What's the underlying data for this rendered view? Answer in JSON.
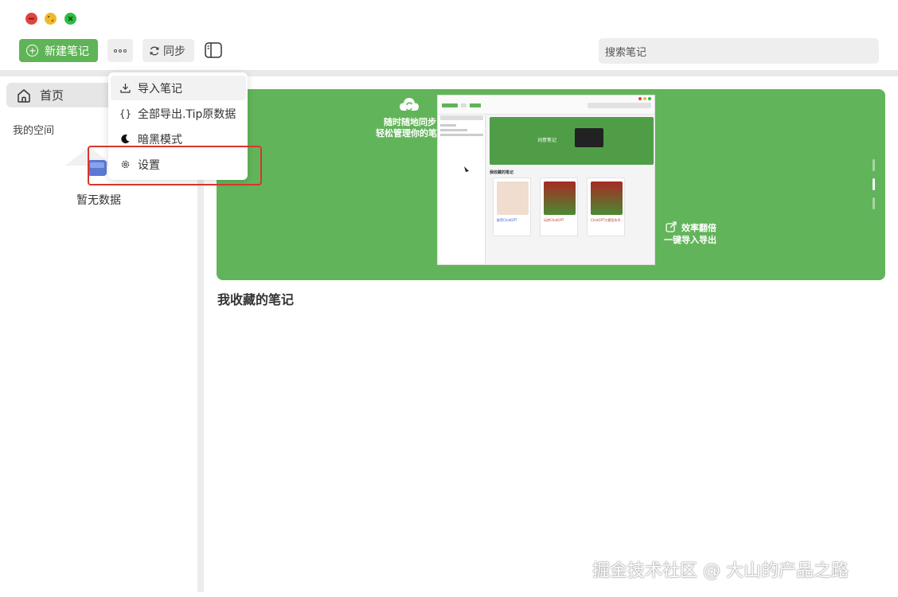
{
  "window": {
    "controls": [
      "close",
      "minimize",
      "maximize"
    ]
  },
  "toolbar": {
    "new_note_label": "新建笔记",
    "sync_label": "同步",
    "search_placeholder": "搜索笔记"
  },
  "sidebar": {
    "home_label": "首页",
    "space_label": "我的空间",
    "empty_text": "暂无数据"
  },
  "banner": {
    "line1": "随时随地同步",
    "line2": "轻松管理你的笔记",
    "mock_title": "词意笔记",
    "mock_section": "我收藏的笔记",
    "mock_cards": [
      "推荐ChatGPT",
      "玩转ChatGPT",
      "ChatGPT大模型技术..."
    ],
    "line3": "效率翻倍",
    "line4": "一键导入导出"
  },
  "main": {
    "section_title": "我收藏的笔记"
  },
  "menu": {
    "items": [
      {
        "label": "导入笔记",
        "icon": "download-icon"
      },
      {
        "label": "全部导出.Tip原数据",
        "icon": "braces-icon"
      },
      {
        "label": "暗黑模式",
        "icon": "moon-icon"
      },
      {
        "label": "设置",
        "icon": "gear-icon"
      }
    ]
  },
  "watermark": "掘金技术社区 @ 大山的产品之路",
  "colors": {
    "accent": "#5fb457",
    "highlight": "#d7362b"
  }
}
